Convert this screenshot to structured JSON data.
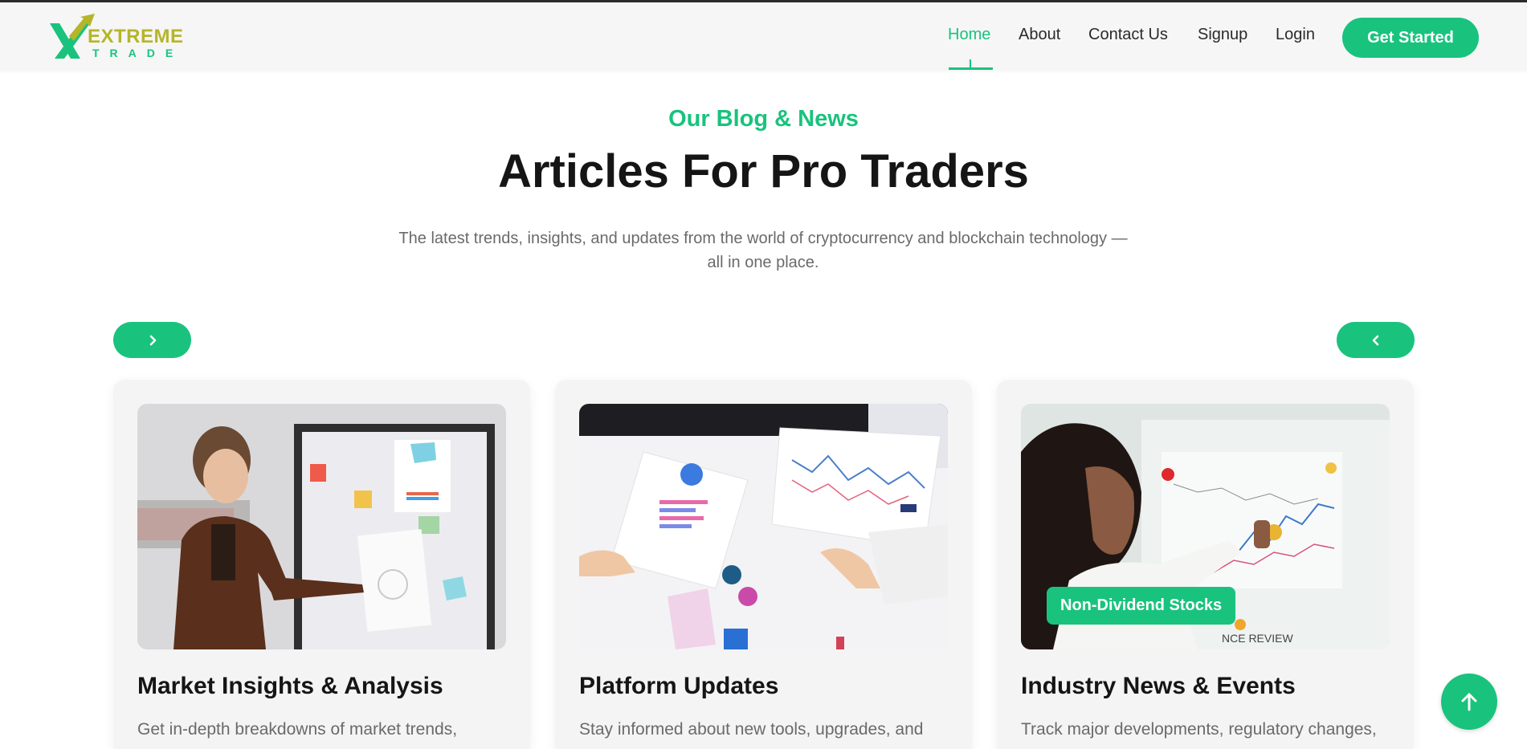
{
  "brand": {
    "logo_line1": "EXTREME",
    "logo_line2": "TRADE",
    "logo_icon": "x-arrow-logo-icon",
    "primary_color": "#19c37d",
    "secondary_color": "#b5b52a"
  },
  "nav": {
    "items": [
      {
        "label": "Home",
        "active": true
      },
      {
        "label": "About",
        "active": false
      },
      {
        "label": "Contact Us",
        "active": false
      },
      {
        "label": "Signup",
        "active": false
      },
      {
        "label": "Login",
        "active": false
      }
    ],
    "cta_label": "Get Started"
  },
  "section": {
    "eyebrow": "Our Blog & News",
    "title": "Articles For Pro Traders",
    "subtitle_line1": "The latest trends, insights, and updates from the world of cryptocurrency and blockchain technology —",
    "subtitle_line2": "all in one place."
  },
  "carousel": {
    "prev_icon": "chevron-right-icon",
    "next_icon": "chevron-left-icon"
  },
  "cards": [
    {
      "title": "Market Insights & Analysis",
      "description": "Get in-depth breakdowns of market trends,",
      "image": "man-presenting-whiteboard-image"
    },
    {
      "title": "Platform Updates",
      "description": "Stay informed about new tools, upgrades, and",
      "image": "hands-holding-charts-image"
    },
    {
      "title": "Industry News & Events",
      "description": "Track major developments, regulatory changes,",
      "image": "woman-analyzing-chart-image",
      "badge": "Non-Dividend Stocks",
      "image_caption": "NCE REVIEW"
    }
  ],
  "scroll_top_icon": "arrow-up-icon"
}
